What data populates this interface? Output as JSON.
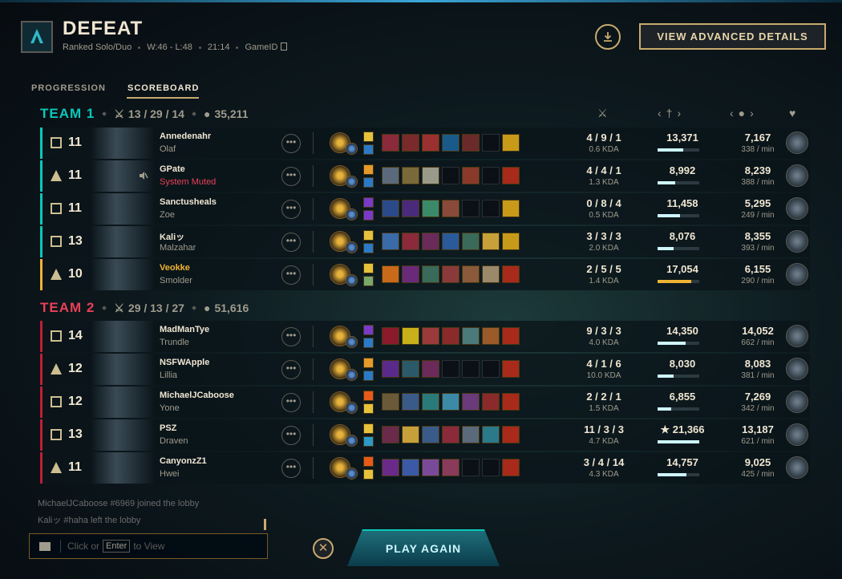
{
  "header": {
    "title": "DEFEAT",
    "queue": "Ranked Solo/Duo",
    "record": "W:46 - L:48",
    "duration": "21:14",
    "game_id_label": "GameID",
    "advanced_button": "VIEW ADVANCED DETAILS"
  },
  "tabs": [
    {
      "label": "PROGRESSION"
    },
    {
      "label": "SCOREBOARD"
    }
  ],
  "teams": [
    {
      "name": "TEAM 1",
      "color": "#0ac8b9",
      "kda": "13 / 29 / 14",
      "gold": "35,211"
    },
    {
      "name": "TEAM 2",
      "color": "#e84057",
      "kda": "29 / 13 / 27",
      "gold": "51,616"
    }
  ],
  "players": [
    {
      "name": "Annedenahr",
      "champion": "Olaf",
      "level": "11",
      "kda": "4 / 9 / 1",
      "kda_ratio": "0.6 KDA",
      "damage": "13,371",
      "dmg_pct": 0.62,
      "gold": "7,167",
      "gpm": "338 / min",
      "role": "top"
    },
    {
      "name": "GPate",
      "champion": "System Muted",
      "level": "11",
      "kda": "4 / 4 / 1",
      "kda_ratio": "1.3 KDA",
      "damage": "8,992",
      "dmg_pct": 0.42,
      "gold": "8,239",
      "gpm": "388 / min",
      "role": "jungle"
    },
    {
      "name": "Sanctusheals",
      "champion": "Zoe",
      "level": "11",
      "kda": "0 / 8 / 4",
      "kda_ratio": "0.5 KDA",
      "damage": "11,458",
      "dmg_pct": 0.54,
      "gold": "5,295",
      "gpm": "249 / min",
      "role": "mid"
    },
    {
      "name": "Kaliッ",
      "champion": "Malzahar",
      "level": "13",
      "kda": "3 / 3 / 3",
      "kda_ratio": "2.0 KDA",
      "damage": "8,076",
      "dmg_pct": 0.38,
      "gold": "8,355",
      "gpm": "393 / min",
      "role": "top"
    },
    {
      "name": "Veokke",
      "champion": "Smolder",
      "level": "10",
      "kda": "2 / 5 / 5",
      "kda_ratio": "1.4 KDA",
      "damage": "17,054",
      "dmg_pct": 0.8,
      "gold": "6,155",
      "gpm": "290 / min",
      "role": "support"
    },
    {
      "name": "MadManTye",
      "champion": "Trundle",
      "level": "14",
      "kda": "9 / 3 / 3",
      "kda_ratio": "4.0 KDA",
      "damage": "14,350",
      "dmg_pct": 0.67,
      "gold": "14,052",
      "gpm": "662 / min",
      "role": "top"
    },
    {
      "name": "NSFWApple",
      "champion": "Lillia",
      "level": "12",
      "kda": "4 / 1 / 6",
      "kda_ratio": "10.0 KDA",
      "damage": "8,030",
      "dmg_pct": 0.38,
      "gold": "8,083",
      "gpm": "381 / min",
      "role": "jungle"
    },
    {
      "name": "MichaelJCaboose",
      "champion": "Yone",
      "level": "12",
      "kda": "2 / 2 / 1",
      "kda_ratio": "1.5 KDA",
      "damage": "6,855",
      "dmg_pct": 0.32,
      "gold": "7,269",
      "gpm": "342 / min",
      "role": "mid"
    },
    {
      "name": "PSZ",
      "champion": "Draven",
      "level": "13",
      "kda": "11 / 3 / 3",
      "kda_ratio": "4.7 KDA",
      "damage": "★ 21,366",
      "dmg_pct": 1.0,
      "gold": "13,187",
      "gpm": "621 / min",
      "role": "top"
    },
    {
      "name": "CanyonzZ1",
      "champion": "Hwei",
      "level": "11",
      "kda": "3 / 4 / 14",
      "kda_ratio": "4.3 KDA",
      "damage": "14,757",
      "dmg_pct": 0.69,
      "gold": "9,025",
      "gpm": "425 / min",
      "role": "support"
    }
  ],
  "more_label": "•••",
  "chat": {
    "lines": [
      "MichaelJCaboose #6969 joined the lobby",
      "Kaliッ #haha left the lobby"
    ],
    "input_prefix": "Click or",
    "input_key": "Enter",
    "input_suffix": "to View"
  },
  "close_label": "✕",
  "play_again": "PLAY AGAIN",
  "colors": {
    "gold": "#c8aa6e",
    "blue_team": "#0ac8b9",
    "red_team": "#be1e37",
    "self": "#f0b232"
  }
}
